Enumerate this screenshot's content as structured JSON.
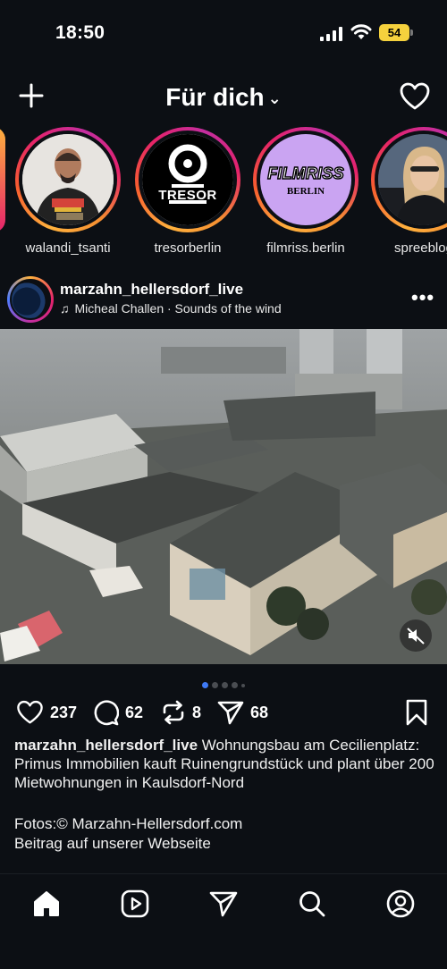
{
  "status_bar": {
    "time": "18:50",
    "battery": "54"
  },
  "header": {
    "title": "Für dich",
    "chevron": "⌄"
  },
  "stories": [
    {
      "name": "walandi_tsanti"
    },
    {
      "name": "tresorberlin",
      "logo_text": "TRESOR"
    },
    {
      "name": "filmriss.berlin",
      "logo_text_1": "FILMRISS",
      "logo_text_2": "BERLIN"
    },
    {
      "name": "spreeblog"
    }
  ],
  "post": {
    "username": "marzahn_hellersdorf_live",
    "music": "Micheal Challen · Sounds of the wind",
    "likes": "237",
    "comments": "62",
    "reposts": "8",
    "shares": "68",
    "caption_user": "marzahn_hellersdorf_live",
    "caption_text": " Wohnungsbau am Cecilienplatz: Primus Immobilien kauft Ruinengrundstück und plant über 200 Mietwohnungen in Kaulsdorf-Nord",
    "credits_line1": "Fotos:© Marzahn-Hellersdorf.com",
    "credits_line2": "Beitrag auf unserer Webseite",
    "carousel_active": 1,
    "carousel_count": 5
  },
  "colors": {
    "background": "#0c0f14",
    "accent": "#3f7af6",
    "battery": "#f5d13d"
  }
}
